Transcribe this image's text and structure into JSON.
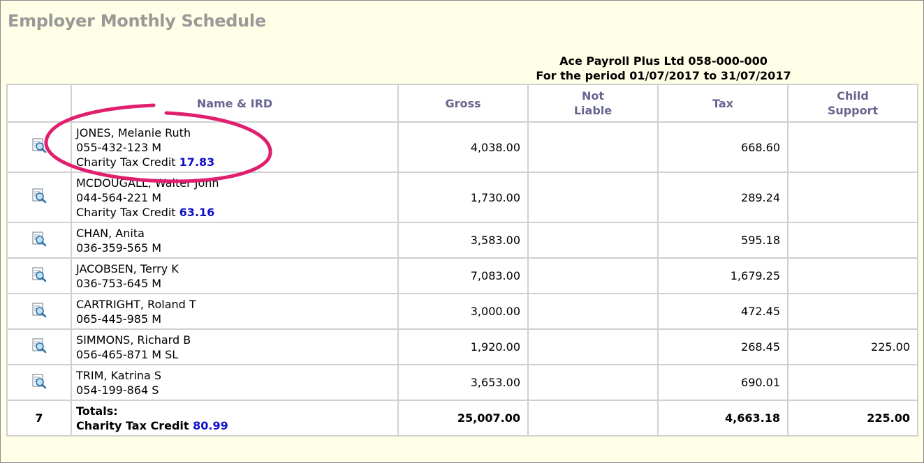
{
  "page": {
    "title": "Employer Monthly Schedule"
  },
  "header": {
    "employer": "Ace Payroll Plus Ltd 058-000-000",
    "period": "For the period 01/07/2017 to 31/07/2017"
  },
  "columns": {
    "name": "Name & IRD",
    "gross": "Gross",
    "not_liable_1": "Not",
    "not_liable_2": "Liable",
    "tax": "Tax",
    "child_support_1": "Child",
    "child_support_2": "Support"
  },
  "rows": [
    {
      "name": "JONES, Melanie Ruth",
      "ird": "055-432-123 M",
      "credit_label": "Charity Tax Credit",
      "credit_value": "17.83",
      "gross": "4,038.00",
      "not_liable": "",
      "tax": "668.60",
      "child_support": ""
    },
    {
      "name": "MCDOUGALL, Walter John",
      "ird": "044-564-221 M",
      "credit_label": "Charity Tax Credit",
      "credit_value": "63.16",
      "gross": "1,730.00",
      "not_liable": "",
      "tax": "289.24",
      "child_support": ""
    },
    {
      "name": "CHAN, Anita",
      "ird": "036-359-565 M",
      "gross": "3,583.00",
      "not_liable": "",
      "tax": "595.18",
      "child_support": ""
    },
    {
      "name": "JACOBSEN, Terry K",
      "ird": "036-753-645 M",
      "gross": "7,083.00",
      "not_liable": "",
      "tax": "1,679.25",
      "child_support": ""
    },
    {
      "name": "CARTRIGHT, Roland T",
      "ird": "065-445-985 M",
      "gross": "3,000.00",
      "not_liable": "",
      "tax": "472.45",
      "child_support": ""
    },
    {
      "name": "SIMMONS, Richard B",
      "ird": "056-465-871 M SL",
      "gross": "1,920.00",
      "not_liable": "",
      "tax": "268.45",
      "child_support": "225.00"
    },
    {
      "name": "TRIM, Katrina S",
      "ird": "054-199-864 S",
      "gross": "3,653.00",
      "not_liable": "",
      "tax": "690.01",
      "child_support": ""
    }
  ],
  "totals": {
    "count": "7",
    "label": "Totals:",
    "credit_label": "Charity Tax Credit",
    "credit_value": "80.99",
    "gross": "25,007.00",
    "not_liable": "",
    "tax": "4,663.18",
    "child_support": "225.00"
  },
  "icons": {
    "row_icon": "view-document-icon"
  },
  "colors": {
    "background": "#fffee6",
    "header_text": "#66668f",
    "credit_value": "#1010cc",
    "annotation": "#e0206f",
    "title": "#999999"
  }
}
